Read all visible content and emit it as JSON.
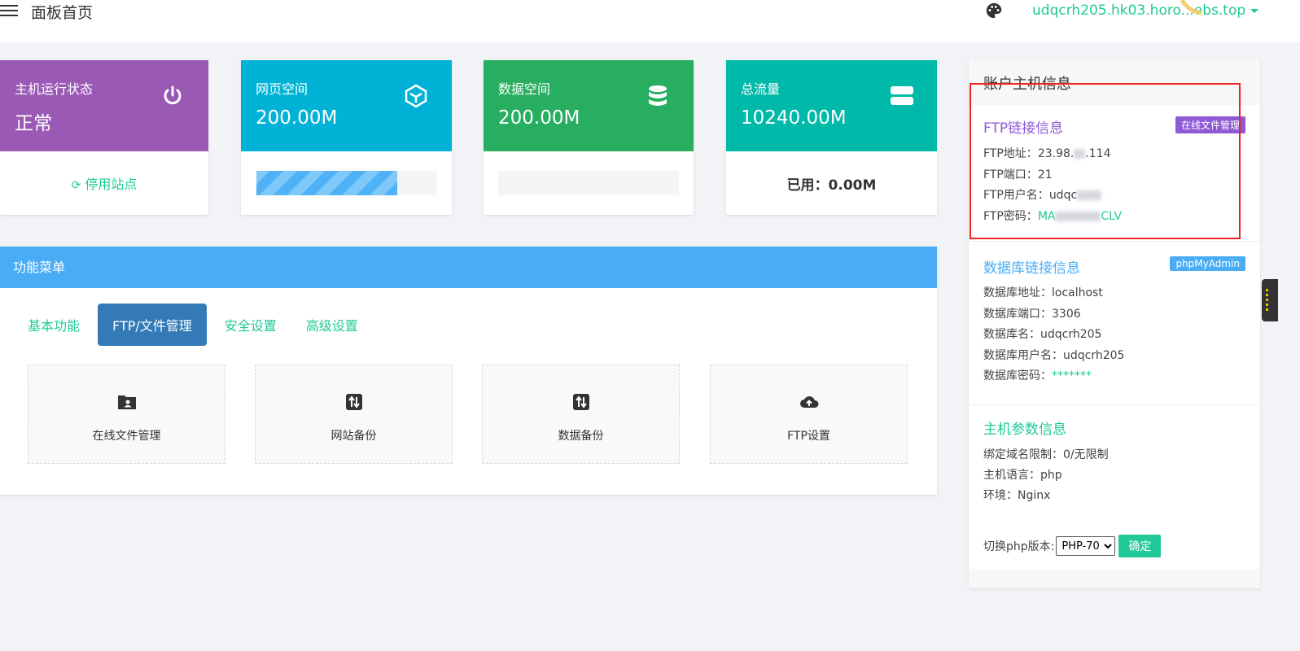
{
  "header": {
    "title": "面板首页",
    "domain": "udqcrh205.hk03.horo...ebs.top",
    "menu_icon": "hamburger-menu-icon",
    "theme_icon": "palette-icon"
  },
  "stats": [
    {
      "label": "主机运行状态",
      "value": "正常",
      "icon": "power-icon",
      "color": "#9b59b6",
      "footer": "停用站点"
    },
    {
      "label": "网页空间",
      "value": "200.00M",
      "icon": "cube-icon",
      "color": "#00b3d6",
      "progress": 0.78
    },
    {
      "label": "数据空间",
      "value": "200.00M",
      "icon": "database-icon",
      "color": "#27ae60",
      "progress": 0
    },
    {
      "label": "总流量",
      "value": "10240.00M",
      "icon": "server-icon",
      "color": "#00b9a8",
      "footer": "已用：0.00M"
    }
  ],
  "menu": {
    "title": "功能菜单",
    "tabs": [
      "基本功能",
      "FTP/文件管理",
      "安全设置",
      "高级设置"
    ],
    "active_tab": "FTP/文件管理",
    "items": [
      {
        "label": "在线文件管理",
        "icon": "folder-user-icon"
      },
      {
        "label": "网站备份",
        "icon": "transfer-icon"
      },
      {
        "label": "数据备份",
        "icon": "transfer-icon"
      },
      {
        "label": "FTP设置",
        "icon": "cloud-upload-icon"
      }
    ]
  },
  "account": {
    "title": "账户主机信息",
    "ftp": {
      "title": "FTP链接信息",
      "badge": "在线文件管理",
      "address_label": "FTP地址：",
      "address": "23.98.",
      "address_tail": ".114",
      "port_label": "FTP端口：",
      "port": "21",
      "user_label": "FTP用户名：",
      "user": "udqc",
      "pass_label": "FTP密码：",
      "pass": "MA",
      "pass_tail": "CLV"
    },
    "db": {
      "title": "数据库链接信息",
      "badge": "phpMyAdmin",
      "address_label": "数据库地址：",
      "address": "localhost",
      "port_label": "数据库端口：",
      "port": "3306",
      "name_label": "数据库名：",
      "name": "udqcrh205",
      "user_label": "数据库用户名：",
      "user": "udqcrh205",
      "pass_label": "数据库密码：",
      "pass": "*******"
    },
    "host": {
      "title": "主机参数信息",
      "domain_limit_label": "绑定域名限制：",
      "domain_limit": "0/无限制",
      "lang_label": "主机语言：",
      "lang": "php",
      "env_label": "环境：",
      "env": "Nginx"
    },
    "php_switch": {
      "label": "切换php版本:",
      "selected": "PHP-70",
      "button": "确定"
    }
  },
  "colors": {
    "accent": "#20c997",
    "menu_header": "#4aacf4",
    "active_tab": "#337ab7",
    "ftp_title": "#8e5ad6",
    "db_title": "#4aacf4",
    "host_title": "#20c997",
    "highlight": "#ee2222"
  }
}
